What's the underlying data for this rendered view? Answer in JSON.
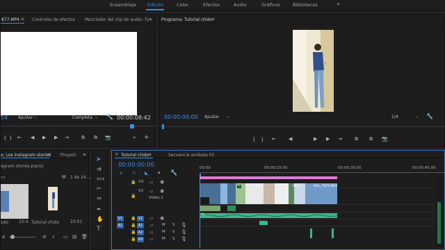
{
  "workspaces": [
    "Ensamblaje",
    "Edición",
    "Color",
    "Efectos",
    "Audio",
    "Gráficos",
    "Bibliotecas"
  ],
  "workspace_more": "»",
  "source_panel": {
    "tabs": [
      "877.MP4",
      "Controles de efectos",
      "Mezclador del clip de audio: Tu"
    ],
    "tab_more": "»",
    "timecode_left": "54",
    "fit_label": "Ajustar",
    "quality_label": "Completa",
    "duration": "00:00:08:42"
  },
  "program_panel": {
    "title": "Programa: Tutorial chido",
    "timecode": "00:00:00:00",
    "fit_label": "Ajustar",
    "quality_label": "1/4"
  },
  "project_panel": {
    "tab_label": "o: Los Instagram stories",
    "tab2_label": "Proyect",
    "tab_more": "»",
    "file_name": "agram stories.prproj",
    "page_info": "1 de 24 ...",
    "items": [
      {
        "name": "odo",
        "duration": "12:4"
      },
      {
        "name": "Tutorial chido",
        "duration": "23:01"
      }
    ]
  },
  "timeline": {
    "tabs": [
      "Tutorial chido",
      "Secuencia anidada 05"
    ],
    "timecode": "00:00:00:00",
    "ruler": [
      "00:00",
      "00:00:15:00",
      "00:00:30:00",
      "00:00:45:00"
    ],
    "tracks": {
      "v3": "V3",
      "v2": "V2",
      "v2_name": "Vídeo 2",
      "v1": "V1",
      "a1": "A1",
      "a2": "A2",
      "a3": "A3",
      "m": "M",
      "s": "S"
    },
    "clips": {
      "mv1": "MVL",
      "mv2": "MVL",
      "mv3": "MVL_7879.MP4",
      "fx": "fx"
    }
  },
  "colors": {
    "accent": "#3a8fe8",
    "clip_pink": "#e17ad6",
    "clip_blue": "#8bb6e0",
    "clip_green": "#2f8f5a",
    "audio_green": "#3fb58a",
    "playhead": "#4a90e2"
  }
}
